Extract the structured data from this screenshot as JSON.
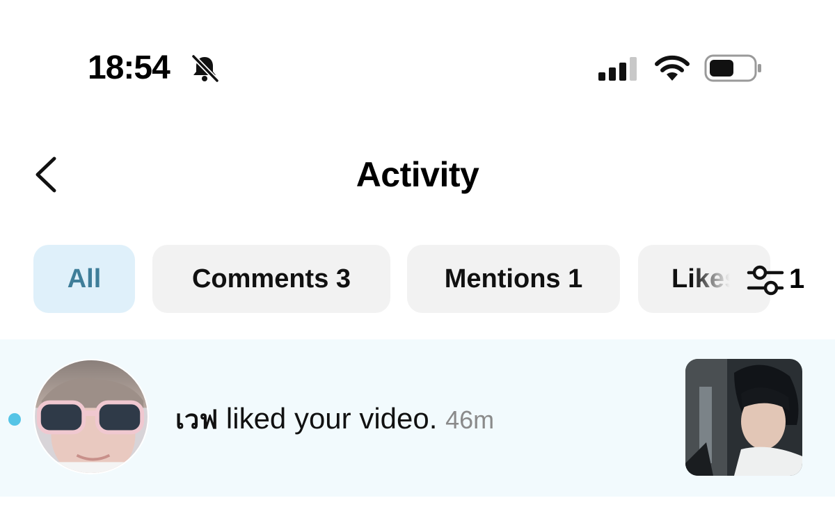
{
  "status_bar": {
    "time": "18:54",
    "icons": [
      "bell-slash-icon",
      "cellular-signal-icon",
      "wifi-icon",
      "battery-icon"
    ]
  },
  "header": {
    "title": "Activity",
    "back_icon": "chevron-left-icon"
  },
  "tabs": [
    {
      "label": "All",
      "active": true
    },
    {
      "label": "Comments 3",
      "active": false
    },
    {
      "label": "Mentions 1",
      "active": false
    },
    {
      "label": "Likes",
      "count": "1",
      "active": false
    }
  ],
  "filter_icon": "filter-sliders-icon",
  "notifications": [
    {
      "user": "เวฟ",
      "action": " liked your video.",
      "time": "46m",
      "unread": true
    }
  ],
  "colors": {
    "active_tab_bg": "#dff0fa",
    "active_tab_text": "#3f7e99",
    "row_bg": "#f2fafd",
    "unread_dot": "#55c4e6"
  }
}
